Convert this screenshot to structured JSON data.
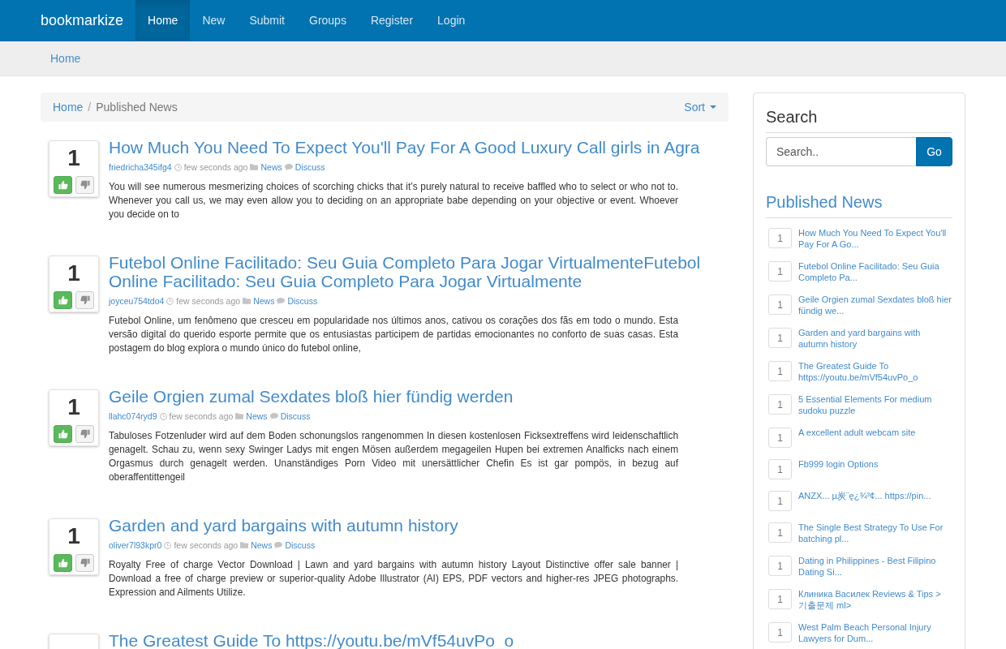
{
  "navbar": {
    "brand": "bookmarkize",
    "items": [
      {
        "label": "Home",
        "selected": true
      },
      {
        "label": "New",
        "selected": false
      },
      {
        "label": "Submit",
        "selected": false
      },
      {
        "label": "Groups",
        "selected": false
      },
      {
        "label": "Register",
        "selected": false
      },
      {
        "label": "Login",
        "selected": false
      }
    ]
  },
  "subbar": {
    "link": "Home"
  },
  "breadcrumb": {
    "items": [
      "Home",
      "Published News"
    ],
    "separator": "/",
    "sort": "Sort"
  },
  "posts": [
    {
      "votes": "1",
      "title": "How Much You Need To Expect You'll Pay For A Good Luxury Call girls in Agra",
      "author": "friedricha345ifg4",
      "time": "few seconds ago",
      "category": "News",
      "discuss": "Discuss",
      "text": "You will see numerous mesmerizing choices of scorching chicks that it’s purely natural to receive baffled who to select or who not to. Whenever you call us, we may even allow you to deciding on an appropriate babe depending on your objective or event. Whoever you decide on to"
    },
    {
      "votes": "1",
      "title": "Futebol Online Facilitado: Seu Guia Completo Para Jogar VirtualmenteFutebol Online Facilitado: Seu Guia Completo Para Jogar Virtualmente",
      "author": "joyceu754tdo4",
      "time": "few seconds ago",
      "category": "News",
      "discuss": "Discuss",
      "text": "Futebol Online, um fenômeno que cresceu em popularidade nos últimos anos, cativou os corações dos fãs em todo o mundo. Esta versão digital do querido esporte permite que os entusiastas participem de partidas emocionantes no conforto de suas casas. Esta postagem do blog explora o mundo único do futebol online,"
    },
    {
      "votes": "1",
      "title": "Geile Orgien zumal Sexdates bloß hier fündig werden",
      "author": "llahc074ryd9",
      "time": "few seconds ago",
      "category": "News",
      "discuss": "Discuss",
      "text": "Tabuloses Fotzenluder wird auf dem Boden schonungslos rangenommen In diesen kostenlosen Ficksextreffens wird leidenschaftlich genagelt. Schau zu, wenn sexy Swinger Ladys mit engen Mösen außerdem megageilen Hupen bei extremen Analficks nach einem Orgasmus durch genagelt werden. Unanständiges Porn Video mit unersättlicher Chefin Es ist gar pompös, in bezug auf oberaffentittengeil"
    },
    {
      "votes": "1",
      "title": "Garden and yard bargains with autumn history",
      "author": "oliver7l93kpr0",
      "time": "few seconds ago",
      "category": "News",
      "discuss": "Discuss",
      "text": "Royalty Free of charge Vector Download | Lawn and yard bargains with autumn history Layout Distinctive offer sale banner | Download a free of charge preview or superior-quality Adobe Illustrator (AI) EPS, PDF vectors and higher-res JPEG photographs. Expression and Ailments Utilize."
    },
    {
      "title": "The Greatest Guide To https://youtu.be/mVf54uvPo_o"
    }
  ],
  "sidebar": {
    "search": {
      "heading": "Search",
      "placeholder": "Search..",
      "button": "Go"
    },
    "published": {
      "heading": "Published News",
      "items": [
        {
          "count": "1",
          "title": "How Much You Need To Expect You'll Pay For A Go..."
        },
        {
          "count": "1",
          "title": "Futebol Online Facilitado: Seu Guia Completo Pa..."
        },
        {
          "count": "1",
          "title": "Geile Orgien zumal Sexdates bloß hier fündig we..."
        },
        {
          "count": "1",
          "title": "Garden and yard bargains with autumn history"
        },
        {
          "count": "1",
          "title": "The Greatest Guide To https://youtu.be/mVf54uvPo_o"
        },
        {
          "count": "1",
          "title": "5 Essential Elements For medium sudoku puzzle"
        },
        {
          "count": "1",
          "title": "A excellent adult webcam site"
        },
        {
          "count": "1",
          "title": "Fb999 login Options"
        },
        {
          "count": "1",
          "title": "ANZX... µ炭¨ȩ¿¾³¢... https://pin..."
        },
        {
          "count": "1",
          "title": "The Single Best Strategy To Use For batching pl..."
        },
        {
          "count": "1",
          "title": "Dating in Philippines - Best Filipino Dating Si..."
        },
        {
          "count": "1",
          "title": "Клиника Василек Reviews & Tips > 기출문제 ml>"
        },
        {
          "count": "1",
          "title": "West Palm Beach Personal Injury Lawyers for Dum..."
        }
      ]
    }
  }
}
